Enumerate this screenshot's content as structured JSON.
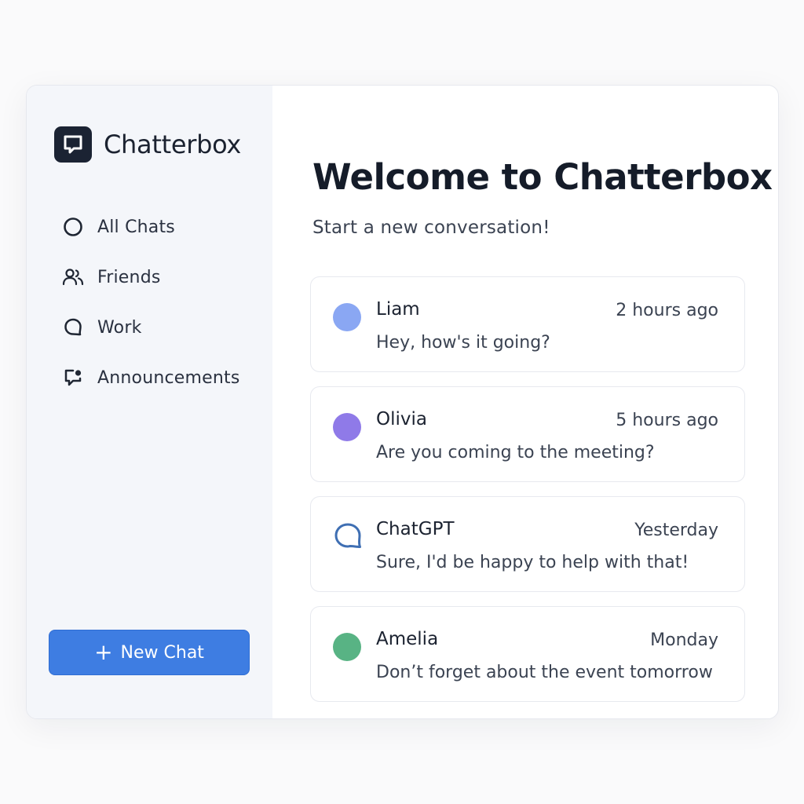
{
  "app": {
    "name": "Chatterbox",
    "logo_icon": "chat-bubble-icon"
  },
  "sidebar": {
    "items": [
      {
        "label": "All Chats",
        "icon": "circle-icon"
      },
      {
        "label": "Friends",
        "icon": "users-icon"
      },
      {
        "label": "Work",
        "icon": "speech-bubble-icon"
      },
      {
        "label": "Announcements",
        "icon": "announcement-icon"
      }
    ],
    "new_chat_label": "New Chat",
    "new_chat_icon": "plus-icon"
  },
  "main": {
    "title": "Welcome to Chatterbox",
    "subtitle": "Start a new conversation!"
  },
  "chats": [
    {
      "name": "Liam",
      "time": "2 hours ago",
      "preview": "Hey, how's it going?",
      "avatar_color": "#8aa7f3"
    },
    {
      "name": "Olivia",
      "time": "5 hours ago",
      "preview": "Are you coming to the meeting?",
      "avatar_color": "#8f7ae8"
    },
    {
      "name": "ChatGPT",
      "time": "Yesterday",
      "preview": "Sure, I'd be happy to help with that!",
      "avatar_icon": "chat-bubble-outline-icon",
      "avatar_color": "#3f6fb3"
    },
    {
      "name": "Amelia",
      "time": "Monday",
      "preview": "Don’t forget about the event tomorrow",
      "avatar_color": "#58b384"
    }
  ],
  "colors": {
    "accent": "#3e7de2",
    "sidebar_bg": "#f4f6fa",
    "logo_bg": "#1b2333"
  }
}
